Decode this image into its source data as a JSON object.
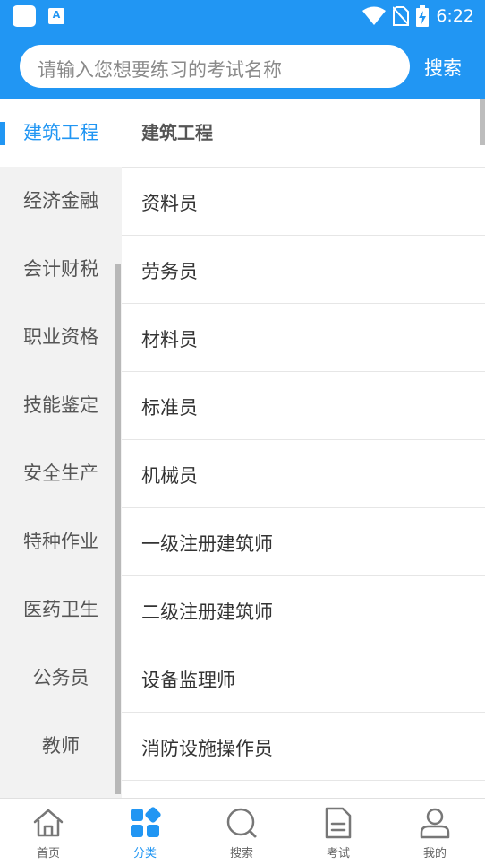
{
  "status_bar": {
    "time": "6:22",
    "icons": [
      "app-square-icon",
      "a-app-icon",
      "wifi-icon",
      "no-sim-icon",
      "battery-charging-icon"
    ]
  },
  "header": {
    "search_placeholder": "请输入您想要练习的考试名称",
    "search_button": "搜索"
  },
  "sidebar": {
    "active_index": 0,
    "items": [
      {
        "label": "建筑工程"
      },
      {
        "label": "经济金融"
      },
      {
        "label": "会计财税"
      },
      {
        "label": "职业资格"
      },
      {
        "label": "技能鉴定"
      },
      {
        "label": "安全生产"
      },
      {
        "label": "特种作业"
      },
      {
        "label": "医药卫生"
      },
      {
        "label": "公务员"
      },
      {
        "label": "教师"
      }
    ]
  },
  "main": {
    "title": "建筑工程",
    "items": [
      {
        "label": "资料员"
      },
      {
        "label": "劳务员"
      },
      {
        "label": "材料员"
      },
      {
        "label": "标准员"
      },
      {
        "label": "机械员"
      },
      {
        "label": "一级注册建筑师"
      },
      {
        "label": "二级注册建筑师"
      },
      {
        "label": "设备监理师"
      },
      {
        "label": "消防设施操作员"
      }
    ]
  },
  "tabbar": {
    "active_index": 1,
    "tabs": [
      {
        "label": "首页",
        "icon": "home-icon"
      },
      {
        "label": "分类",
        "icon": "category-icon"
      },
      {
        "label": "搜索",
        "icon": "search-icon"
      },
      {
        "label": "考试",
        "icon": "document-icon"
      },
      {
        "label": "我的",
        "icon": "user-icon"
      }
    ]
  },
  "colors": {
    "primary": "#2196f3",
    "sidebar_bg": "#f2f2f2",
    "text": "#333333",
    "muted": "#666666"
  }
}
